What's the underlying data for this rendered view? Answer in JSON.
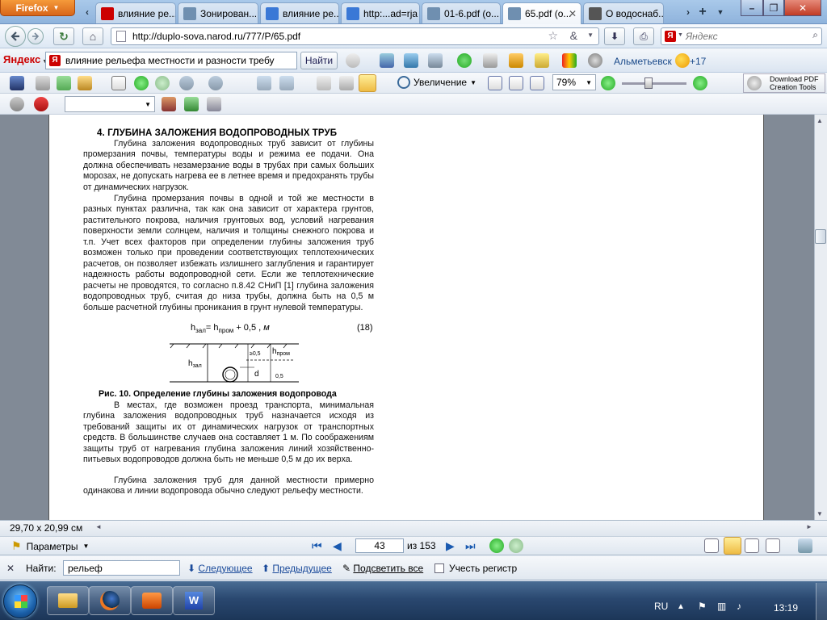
{
  "firefox_button": "Firefox",
  "tabs": [
    {
      "label": "влияние ре...",
      "favicon": "yandex-icon",
      "color": "#cc0000"
    },
    {
      "label": "Зонирован...",
      "favicon": "page-icon",
      "color": "#6f8fb0"
    },
    {
      "label": "влияние ре...",
      "favicon": "google-icon",
      "color": "#3a78d6"
    },
    {
      "label": "http:...ad=rja",
      "favicon": "google-icon",
      "color": "#3a78d6"
    },
    {
      "label": "01-6.pdf (о...",
      "favicon": "page-icon",
      "color": "#6f8fb0"
    },
    {
      "label": "65.pdf (о...",
      "favicon": "page-icon",
      "color": "#6f8fb0"
    },
    {
      "label": "О водоснаб...",
      "favicon": "globe-icon",
      "color": "#555555"
    }
  ],
  "nav": {
    "url": "http://duplo-sova.narod.ru/777/P/65.pdf",
    "search_placeholder": "Яндекс"
  },
  "yandex_bar": {
    "logo": "Яндекс",
    "query": "влияние рельефа местности и разности требу",
    "find_label": "Найти",
    "city": "Альметьевск",
    "temperature": "+17"
  },
  "acrobat": {
    "zoom_label": "Увеличение",
    "zoom_value": "79%",
    "download_line1": "Download PDF",
    "download_line2": "Creation Tools"
  },
  "document": {
    "heading": "4. ГЛУБИНА ЗАЛОЖЕНИЯ ВОДОПРОВОДНЫХ ТРУБ",
    "para1": "Глубина заложения водопроводных труб зависит от глубины промерзания почвы, температуры воды и режима ее подачи. Она должна обеспечивать незамерзание воды в трубах при самых больших морозах, не допускать нагрева ее в летнее время и предохранять трубы от динамических нагрузок.",
    "para2": "Глубина промерзания почвы в одной и той же местности в разных пунктах различна, так как она зависит от характера грунтов, растительного покрова, наличия грунтовых вод, условий нагревания поверхности земли солнцем, наличия и толщины снежного покрова и т.п. Учет всех факторов при определении глубины заложения труб возможен только при проведении соответствующих теплотехнических расчетов, он позволяет избежать излишнего заглубления и гарантирует надежность работы водопроводной сети. Если же теплотехнические расчеты не проводятся, то согласно п.8.42 СНиП [1] глубина заложения водопроводных труб, считая до низа трубы, должна быть на 0,5 м больше расчетной глубины проникания в грунт нулевой температуры.",
    "formula_h": "h",
    "formula_sub1": "зал",
    "formula_mid": "= h",
    "formula_sub2": "пром",
    "formula_end": " + 0,5  ,  ",
    "formula_unit": "м",
    "equation_number": "(18)",
    "fig_h_zal": "h",
    "fig_h_zal_sub": "зал",
    "fig_h_prom": "h",
    "fig_h_prom_sub": "пром",
    "fig_ge05": "≥0,5",
    "fig_d": "d",
    "fig_05": "0,5",
    "figure_caption": "Рис. 10. Определение глубины заложения водопровода",
    "para3": "В местах, где возможен проезд транспорта, минимальная глубина заложения водопроводных труб назначается исходя из требований защиты их от динамических нагрузок от транспортных средств. В большинстве случаев она составляет 1 м. По соображениям защиты труб от нагревания глубина заложения линий хозяйственно-питьевых водопроводов должна быть не меньше 0,5 м до их верха.",
    "para4": "Глубина заложения труб для данной местности примерно одинакова и линии водопровода обычно следуют рельефу местности."
  },
  "status": {
    "page_size": "29,70 x 20,99 см"
  },
  "page_nav": {
    "params_label": "Параметры",
    "current_page": "43",
    "total": "из 153"
  },
  "find_bar": {
    "label": "Найти:",
    "value": "рельеф",
    "next": "Следующее",
    "prev": "Предыдущее",
    "highlight": "Подсветить все",
    "match_case": "Учесть регистр"
  },
  "taskbar": {
    "lang": "RU",
    "time": "13:19"
  }
}
